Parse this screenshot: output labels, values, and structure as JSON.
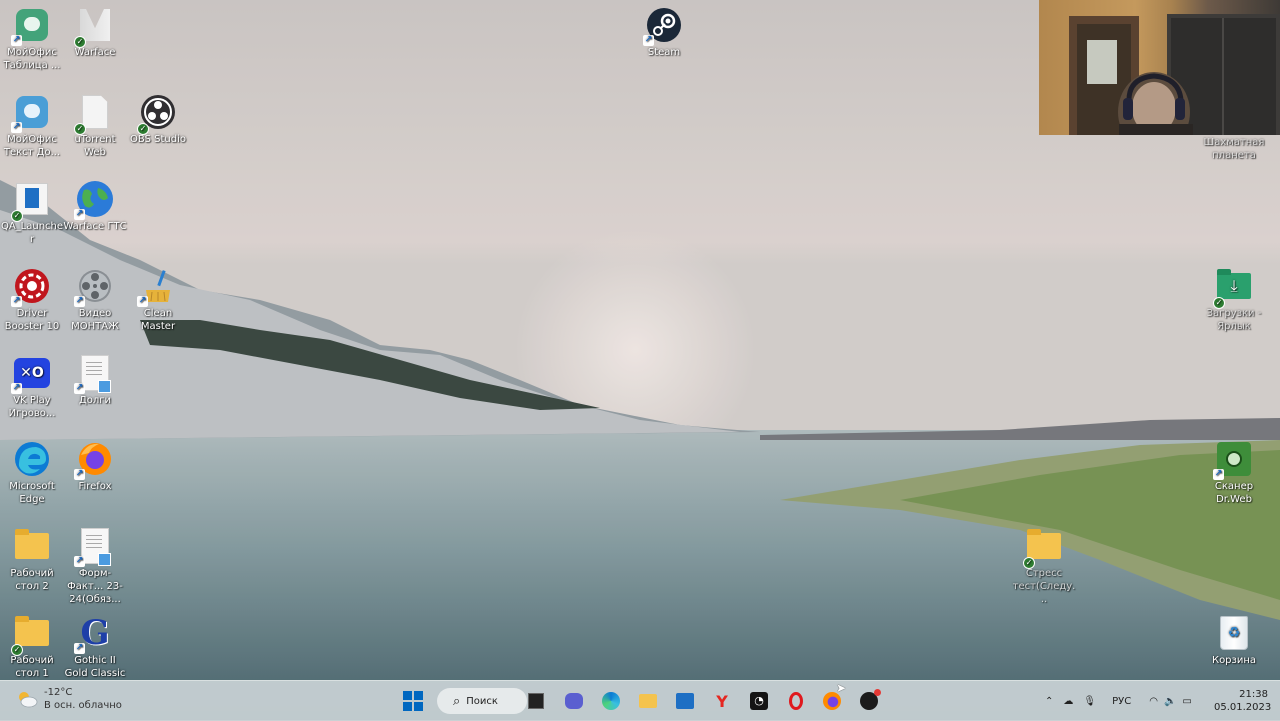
{
  "desktop_icons": {
    "moi_tablitsy": "МойОфис Таблица ...",
    "warface": "Warface",
    "moi_tekst": "МойОфис Текст До...",
    "utorrent": "uTorrent Web",
    "obs": "OBS Studio",
    "qa_launcher": "QA_Launcher",
    "warface_gts": "Warface ГТС",
    "driver_booster": "Driver Booster 10",
    "video_montazh": "Видео МОНТАЖ",
    "clean_master": "Clean Master",
    "vk_play": "VK Play Игрово...",
    "dolgi": "Долги",
    "edge": "Microsoft Edge",
    "firefox": "Firefox",
    "desktop2": "Рабочий стол 2",
    "form_fakt": "Форм-Факт... 23-24(Обяз...",
    "desktop1": "Рабочий стол 1",
    "gothic": "Gothic II Gold Classic",
    "steam": "Steam",
    "chess": "Шахматная планета",
    "downloads": "Загрузки - Ярлык",
    "drweb": "Сканер Dr.Web",
    "stress": "Стресс тест(Следу...",
    "recycle": "Корзина"
  },
  "taskbar": {
    "weather_temp": "-12°C",
    "weather_desc": "В осн. облачно",
    "search_label": "Поиск",
    "lang": "РУС",
    "time": "21:38",
    "date": "05.01.2023"
  },
  "colors": {
    "accent": "#0067c0",
    "taskbar_bg": "#cad2d6"
  },
  "icons": [
    "start-icon",
    "search-icon",
    "task-view-icon",
    "chat-icon",
    "edge-icon",
    "explorer-icon",
    "store-icon",
    "yandex-icon",
    "speedometer-icon",
    "opera-icon",
    "firefox-icon",
    "steam-chess-icon"
  ]
}
